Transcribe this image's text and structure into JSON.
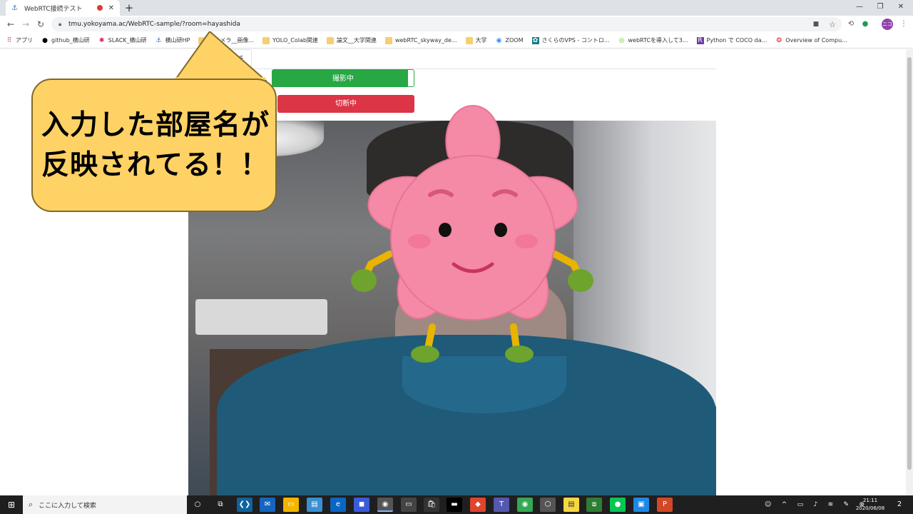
{
  "browser": {
    "tab_title": "WebRTC接続テスト",
    "new_tab": "+",
    "tab_close": "✕",
    "url": "tmu.yokoyama.ac/WebRTC-sample/?room=hayashida",
    "window_controls": {
      "minimize": "—",
      "restore": "❐",
      "close": "✕"
    },
    "profile_initials": "ニコ"
  },
  "bookmarks": [
    {
      "label": "アプリ",
      "icon": "apps-icon"
    },
    {
      "label": "github_横山研",
      "icon": "github-icon"
    },
    {
      "label": "SLACK_横山研",
      "icon": "slack-icon"
    },
    {
      "label": "横山研HP",
      "icon": "anchor-icon"
    },
    {
      "label": "次カメラ__画像...",
      "icon": "folder-icon"
    },
    {
      "label": "YOLO_Colab関連",
      "icon": "folder-icon"
    },
    {
      "label": "論文__大学関連",
      "icon": "folder-icon"
    },
    {
      "label": "webRTC_skyway_de...",
      "icon": "folder-icon"
    },
    {
      "label": "大学",
      "icon": "folder-icon"
    },
    {
      "label": "ZOOM",
      "icon": "zoom-icon"
    },
    {
      "label": "さくらのVPS - コントロ...",
      "icon": "sakura-vps-icon"
    },
    {
      "label": "webRTCを導入して3...",
      "icon": "webrtc-icon"
    },
    {
      "label": "Python で COCO da...",
      "icon": "r-icon"
    },
    {
      "label": "Overview of Compu...",
      "icon": "overview-icon"
    }
  ],
  "page": {
    "tab_call_label": "通話",
    "capture_button_label": "撮影中",
    "disconnect_button_label": "切断中"
  },
  "callout": {
    "line1": "入力した部屋名が",
    "line2": "反映されてる！！"
  },
  "taskbar": {
    "search_placeholder": "ここに入力して検索",
    "time": "21:11",
    "date": "2020/06/08",
    "notification_count": "2"
  },
  "colors": {
    "capture_green": "#28a745",
    "disconnect_red": "#dc3545",
    "callout_fill": "#ffd265",
    "sakura_pink": "#f48aa6"
  }
}
